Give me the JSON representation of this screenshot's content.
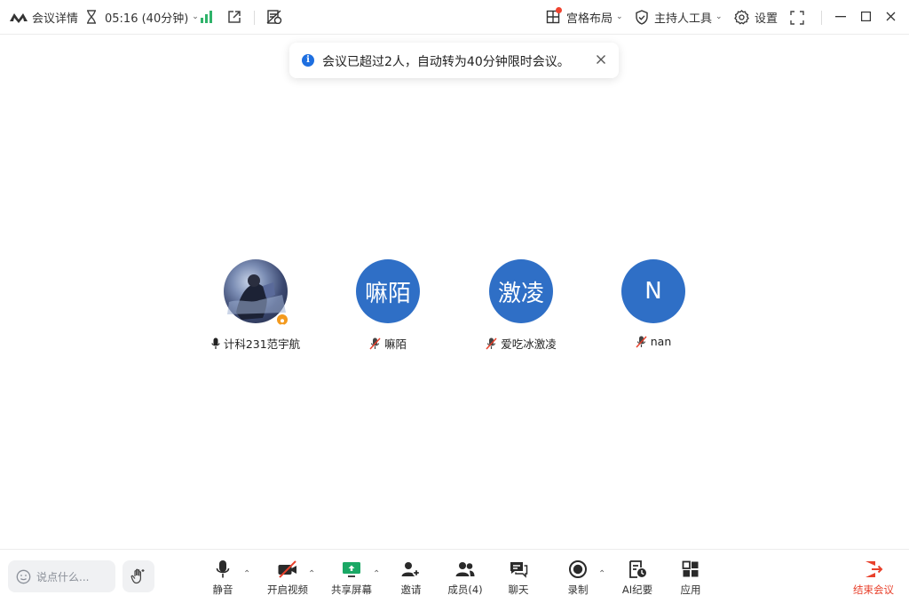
{
  "topbar": {
    "meeting_details": "会议详情",
    "timer": "05:16 (40分钟)",
    "grid_layout": "宫格布局",
    "host_tools": "主持人工具",
    "settings": "设置"
  },
  "toast": {
    "message": "会议已超过2人，自动转为40分钟限时会议。"
  },
  "participants": [
    {
      "name": "计科231范宇航",
      "avatar_text": "",
      "muted": false,
      "is_host": true
    },
    {
      "name": "嘛陌",
      "avatar_text": "嘛陌",
      "muted": true,
      "is_host": false
    },
    {
      "name": "爱吃冰激凌",
      "avatar_text": "激凌",
      "muted": true,
      "is_host": false
    },
    {
      "name": "nan",
      "avatar_text": "N",
      "muted": true,
      "is_host": false
    }
  ],
  "bottombar": {
    "chat_placeholder": "说点什么...",
    "mute": "静音",
    "start_video": "开启视频",
    "share_screen": "共享屏幕",
    "invite": "邀请",
    "members": "成员(4)",
    "chat": "聊天",
    "record": "录制",
    "ai_minutes": "AI纪要",
    "apps": "应用",
    "end_meeting": "结束会议"
  },
  "colors": {
    "accent_blue": "#2f6fc6",
    "signal_green": "#2fb36a",
    "end_red": "#e8412c",
    "share_green": "#1aa865",
    "notification_red": "#f0432f"
  }
}
